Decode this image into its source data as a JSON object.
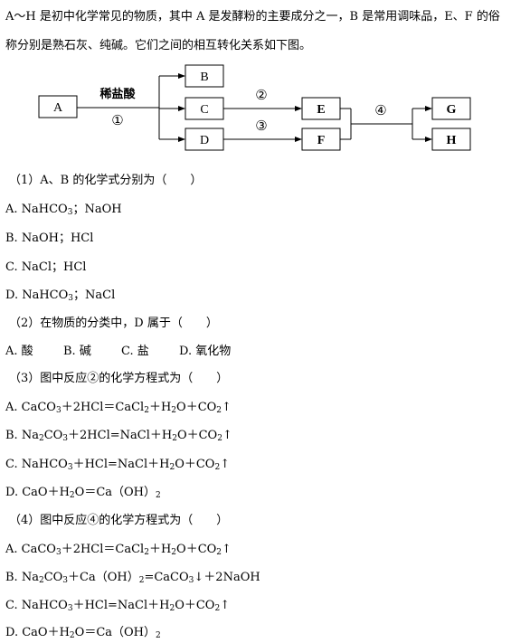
{
  "intro": "A～H 是初中化学常见的物质，其中 A 是发酵粉的主要成分之一，B 是常用调味品，E、F 的俗称分别是熟石灰、纯碱。它们之间的相互转化关系如下图。",
  "diagram": {
    "nodes": {
      "A": "A",
      "B": "B",
      "C": "C",
      "D": "D",
      "E": "E",
      "F": "F",
      "G": "G",
      "H": "H"
    },
    "reagent": "稀盐酸",
    "reaction_labels": [
      "①",
      "②",
      "③",
      "④"
    ]
  },
  "q1": {
    "stem": "（1）A、B 的化学式分别为（　　）",
    "a": [
      "A. NaHCO",
      "3",
      "；NaOH"
    ],
    "b": "B. NaOH；HCl",
    "c": "C. NaCl；HCl",
    "d": [
      "D. NaHCO",
      "3",
      "；NaCl"
    ]
  },
  "q2": {
    "stem": "（2）在物质的分类中，D 属于（　　）",
    "options": [
      "A. 酸",
      "B. 碱",
      "C. 盐",
      "D. 氧化物"
    ]
  },
  "q3": {
    "stem": "（3）图中反应②的化学方程式为（　　）",
    "a": [
      "A. CaCO",
      "3",
      "＋2HCl＝CaCl",
      "2",
      "＋H",
      "2",
      "O＋CO",
      "2",
      "↑"
    ],
    "b": [
      "B. Na",
      "2",
      "CO",
      "3",
      "＋2HCl=NaCl＋H",
      "2",
      "O＋CO",
      "2",
      "↑"
    ],
    "c": [
      "C. NaHCO",
      "3",
      "＋HCl=NaCl＋H",
      "2",
      "O＋CO",
      "2",
      "↑"
    ],
    "d": [
      "D. CaO＋H",
      "2",
      "O＝Ca（OH）",
      "2"
    ]
  },
  "q4": {
    "stem": "（4）图中反应④的化学方程式为（　　）",
    "a": [
      "A. CaCO",
      "3",
      "＋2HCl＝CaCl",
      "2",
      "＋H",
      "2",
      "O＋CO",
      "2",
      "↑"
    ],
    "b": [
      "B. Na",
      "2",
      "CO",
      "3",
      "＋Ca（OH）",
      "2",
      "=CaCO",
      "3",
      "↓＋2NaOH"
    ],
    "c": [
      "C. NaHCO",
      "3",
      "＋HCl=NaCl＋H",
      "2",
      "O＋CO",
      "2",
      "↑"
    ],
    "d": [
      "D. CaO＋H",
      "2",
      "O＝Ca（OH）",
      "2"
    ]
  }
}
